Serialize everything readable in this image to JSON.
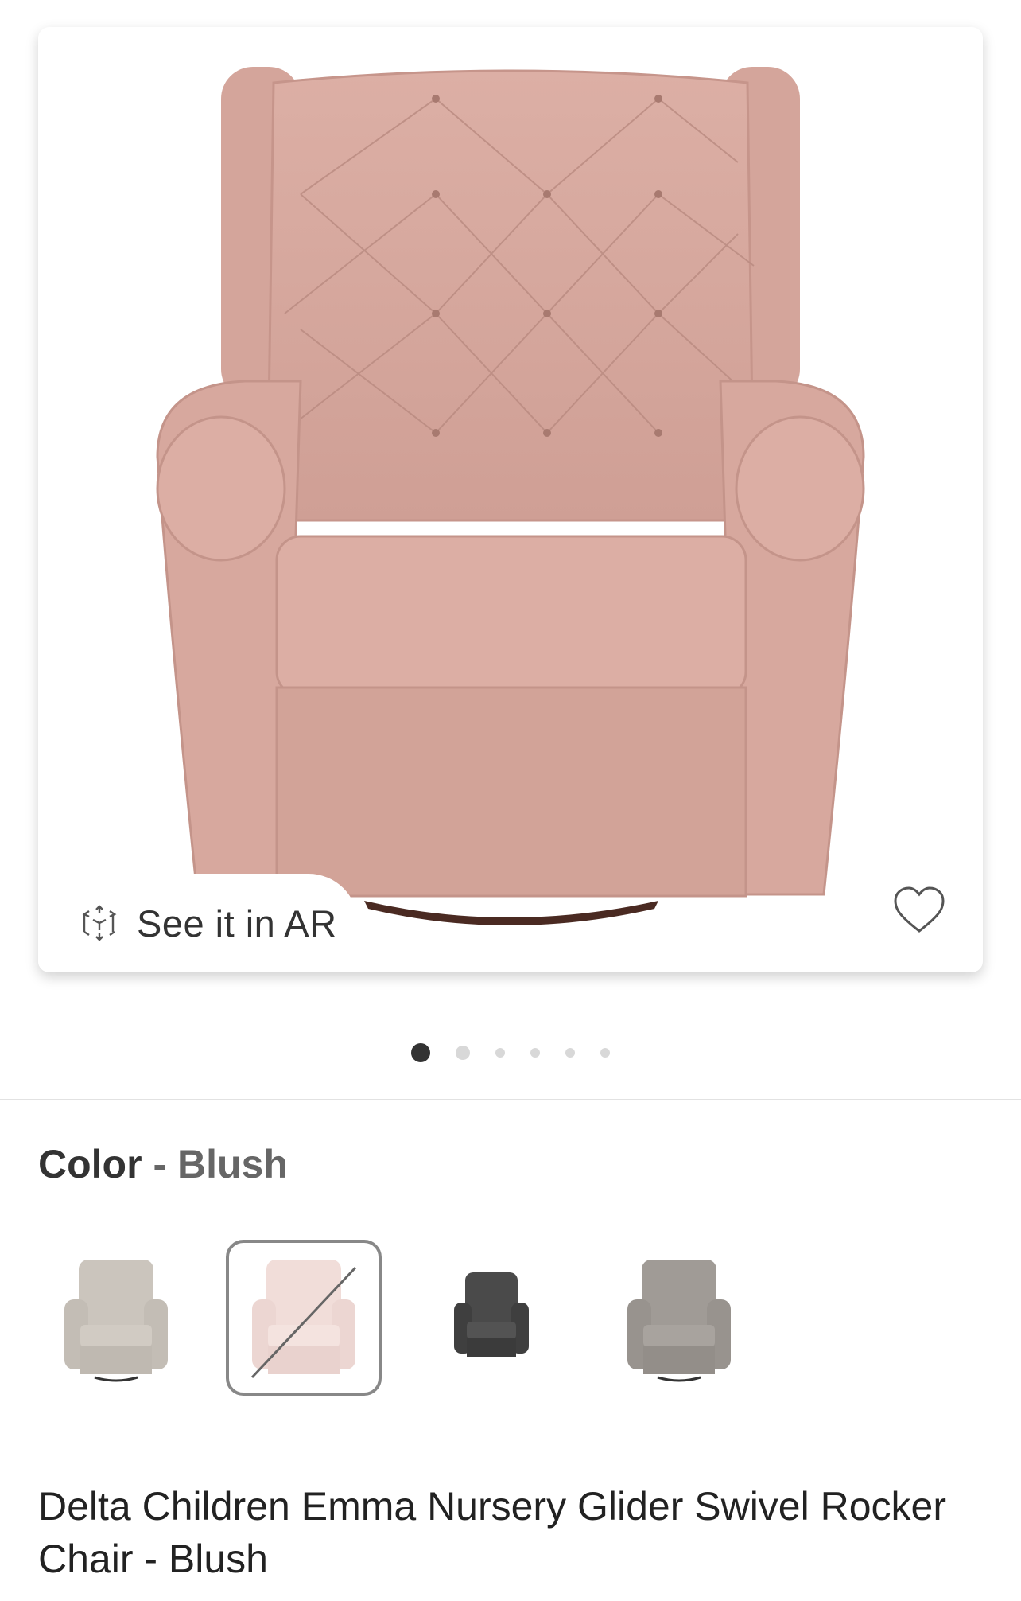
{
  "hero": {
    "ar_label": "See it in AR",
    "ar_icon": "ar-cube-icon",
    "favorite_icon": "heart-icon",
    "chair_color": "#d9aba1"
  },
  "carousel": {
    "total": 6,
    "active_index": 0
  },
  "color_selector": {
    "label": "Color",
    "separator": "-",
    "selected_value": "Blush",
    "swatches": [
      {
        "color": "#c9c3bb",
        "selected": false,
        "available": true
      },
      {
        "color": "#f0dcd8",
        "selected": true,
        "available": false
      },
      {
        "color": "#4a4a4a",
        "selected": false,
        "available": true
      },
      {
        "color": "#9e9994",
        "selected": false,
        "available": true
      }
    ]
  },
  "product": {
    "title": "Delta Children Emma Nursery Glider Swivel Rocker Chair - Blush"
  }
}
